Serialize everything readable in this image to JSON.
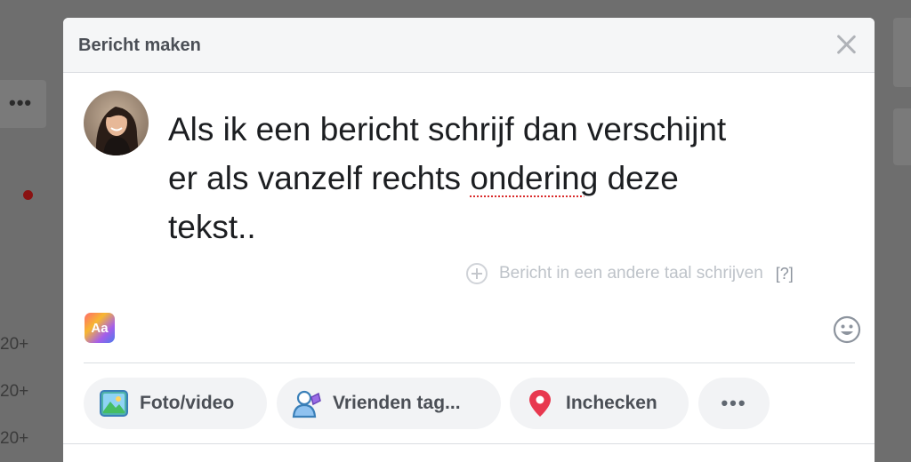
{
  "background": {
    "more_label": "•••",
    "counts": [
      "20+",
      "20+",
      "20+"
    ]
  },
  "modal": {
    "title": "Bericht maken",
    "post_lines": [
      "Als ik een bericht schrijf dan verschijnt",
      "er als vanzelf rechts ",
      "ondering",
      " deze",
      "tekst.."
    ],
    "language_prompt": "Bericht in een andere taal schrijven",
    "language_help": "[?]",
    "text_format_label": "Aa",
    "actions": [
      {
        "label": "Foto/video",
        "icon": "photo-icon"
      },
      {
        "label": "Vrienden tag...",
        "icon": "tag-friends-icon"
      },
      {
        "label": "Inchecken",
        "icon": "location-pin-icon"
      }
    ],
    "more_label": "•••"
  },
  "colors": {
    "overlay": "#6e6e6e",
    "header_bg": "#f5f6f7",
    "button_bg": "#f2f3f5",
    "pin": "#e8384f"
  }
}
